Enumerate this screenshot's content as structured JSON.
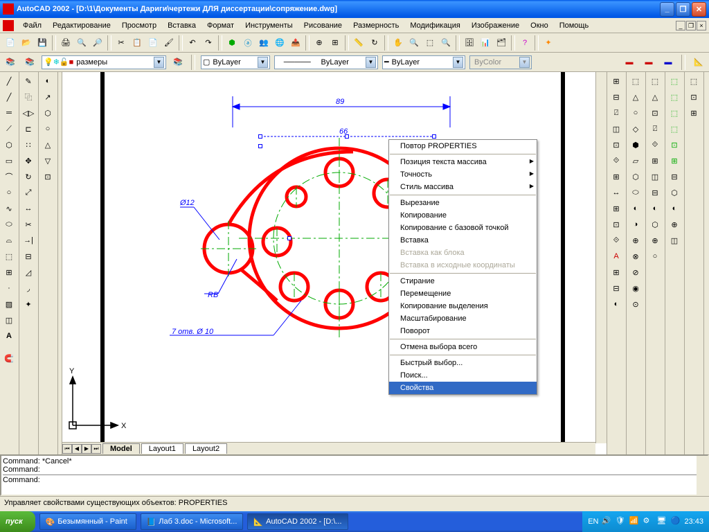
{
  "title": "AutoCAD 2002 - [D:\\1\\Документы Дариги\\чертежи ДЛЯ диссертации\\сопряжение.dwg]",
  "menu": [
    "Файл",
    "Редактирование",
    "Просмотр",
    "Вставка",
    "Формат",
    "Инструменты",
    "Рисование",
    "Размерность",
    "Модификация",
    "Изображение",
    "Окно",
    "Помощь"
  ],
  "layers": {
    "current": "размеры"
  },
  "color": {
    "value": "ByLayer"
  },
  "linetype": {
    "value": "ByLayer"
  },
  "lineweight": {
    "value": "ByLayer"
  },
  "plotstyle": {
    "value": "ByColor"
  },
  "tabs": {
    "model": "Model",
    "layout1": "Layout1",
    "layout2": "Layout2"
  },
  "dimensions": {
    "d89": "89",
    "d66": "66",
    "d12": "Ø12",
    "rb": "RB",
    "holes": "7 отв. Ø 10"
  },
  "context": {
    "items": [
      {
        "label": "Повтор PROPERTIES"
      },
      {
        "sep": true
      },
      {
        "label": "Позиция текста массива",
        "sub": true
      },
      {
        "label": "Точность",
        "sub": true
      },
      {
        "label": "Стиль массива",
        "sub": true
      },
      {
        "sep": true
      },
      {
        "label": "Вырезание"
      },
      {
        "label": "Копирование"
      },
      {
        "label": "Копирование с базовой точкой"
      },
      {
        "label": "Вставка"
      },
      {
        "label": "Вставка как блока",
        "disabled": true
      },
      {
        "label": "Вставка в исходные координаты",
        "disabled": true
      },
      {
        "sep": true
      },
      {
        "label": "Стирание"
      },
      {
        "label": "Перемещение"
      },
      {
        "label": "Копирование выделения"
      },
      {
        "label": "Масштабирование"
      },
      {
        "label": "Поворот"
      },
      {
        "sep": true
      },
      {
        "label": "Отмена выбора всего"
      },
      {
        "sep": true
      },
      {
        "label": "Быстрый выбор..."
      },
      {
        "label": "Поиск..."
      },
      {
        "label": "Свойства",
        "hl": true
      }
    ]
  },
  "command": {
    "l1": "Command:  *Cancel*",
    "l2": "Command:",
    "l3": "Command:"
  },
  "status": "Управляет свойствами существующих объектов: PROPERTIES",
  "taskbar": {
    "start": "пуск",
    "t1": "Безымянный - Paint",
    "t2": "Лаб 3.doc - Microsoft...",
    "t3": "AutoCAD 2002 - [D:\\...",
    "lang": "EN",
    "time": "23:43"
  }
}
